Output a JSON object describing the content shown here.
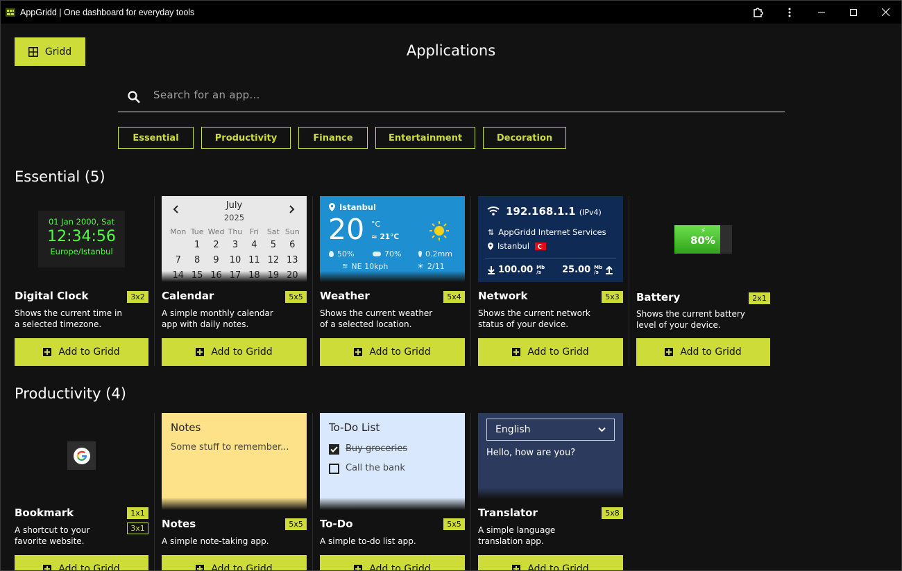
{
  "window": {
    "title": "AppGridd | One dashboard for everyday tools"
  },
  "header": {
    "gridd_label": "Gridd",
    "page_title": "Applications"
  },
  "search": {
    "placeholder": "Search for an app..."
  },
  "categories": [
    "Essential",
    "Productivity",
    "Finance",
    "Entertainment",
    "Decoration"
  ],
  "sections": {
    "essential": "Essential (5)",
    "productivity": "Productivity (4)"
  },
  "add_label": "Add to Gridd",
  "apps": {
    "clock": {
      "name": "Digital Clock",
      "size": "3x2",
      "desc1": "Shows the current time in",
      "desc2": "a selected timezone.",
      "preview": {
        "date": "01 Jan 2000, Sat",
        "time": "12:34:56",
        "zone": "Europe/Istanbul"
      }
    },
    "calendar": {
      "name": "Calendar",
      "size": "5x5",
      "desc1": "A simple monthly calendar",
      "desc2": "app with daily notes.",
      "preview": {
        "month": "July",
        "year": "2025",
        "days": [
          "Mon",
          "Tue",
          "Wed",
          "Thu",
          "Fri",
          "Sat",
          "Sun"
        ],
        "rows": [
          [
            "",
            "",
            "1",
            "2",
            "3",
            "4",
            "5",
            "6"
          ],
          [
            "7",
            "8",
            "9",
            "10",
            "11",
            "12",
            "13"
          ],
          [
            "14",
            "15",
            "16",
            "17",
            "18",
            "19",
            "20"
          ]
        ]
      }
    },
    "weather": {
      "name": "Weather",
      "size": "5x4",
      "desc1": "Shows the current weather",
      "desc2": "of a selected location.",
      "preview": {
        "city": "Istanbul",
        "temp": "20",
        "unit": "°C",
        "feels": "≈ 21°C",
        "humidity": "50%",
        "cloud": "70%",
        "rain": "0.2mm",
        "wind": "NE 10kph",
        "uv": "2/11"
      }
    },
    "network": {
      "name": "Network",
      "size": "5x3",
      "desc1": "Shows the current network",
      "desc2": "status of your device.",
      "preview": {
        "ip": "192.168.1.1",
        "ipver": "(IPv4)",
        "isp": "AppGridd Internet Services",
        "city": "Istanbul",
        "down": "100.00",
        "up": "25.00",
        "unit_top": "Mb",
        "unit_bottom": "/s"
      }
    },
    "battery": {
      "name": "Battery",
      "size": "2x1",
      "desc1": "Shows the current battery",
      "desc2": "level of your device.",
      "preview": {
        "level": "80%",
        "fraction": 0.8
      }
    },
    "bookmark": {
      "name": "Bookmark",
      "size1": "1x1",
      "size2": "3x1",
      "desc1": "A shortcut to your",
      "desc2": "favorite website."
    },
    "notes": {
      "name": "Notes",
      "size": "5x5",
      "desc1": "A simple note-taking app.",
      "preview": {
        "title": "Notes",
        "text": "Some stuff to remember..."
      }
    },
    "todo": {
      "name": "To-Do",
      "size": "5x5",
      "desc1": "A simple to-do list app.",
      "preview": {
        "title": "To-Do List",
        "item1": "Buy groceries",
        "item2": "Call the bank"
      }
    },
    "translator": {
      "name": "Translator",
      "size": "5x8",
      "desc1": "A simple language",
      "desc2": "translation app.",
      "preview": {
        "language": "English",
        "text": "Hello, how are you?"
      }
    }
  },
  "colors": {
    "accent": "#cddc39",
    "background": "#121212",
    "weather_bg": "#1e8fd0",
    "network_bg": "#0f2a55",
    "notes_bg": "#fde28a",
    "todo_bg": "#d9e8fc",
    "translator_bg": "#2c3a5e"
  }
}
